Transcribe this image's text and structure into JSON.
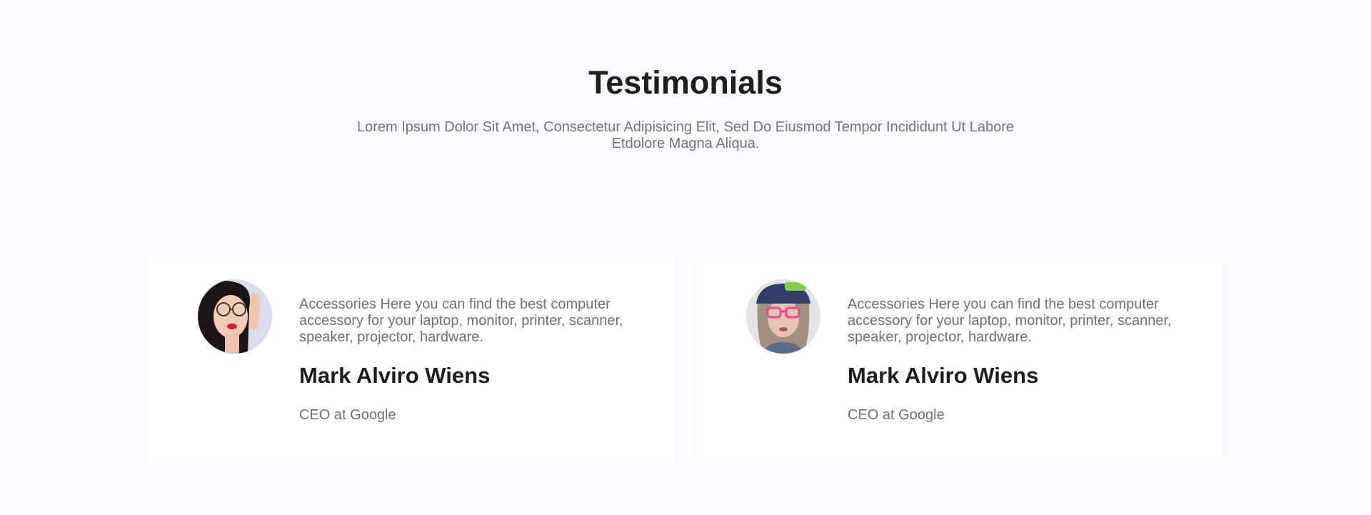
{
  "section": {
    "title": "Testimonials",
    "subtitle": "Lorem Ipsum Dolor Sit Amet, Consectetur Adipisicing Elit, Sed Do Eiusmod Tempor Incididunt Ut Labore Etdolore Magna Aliqua."
  },
  "testimonials": [
    {
      "quote": "Accessories Here you can find the best computer accessory for your laptop, monitor, printer, scanner, speaker, projector, hardware.",
      "name": "Mark Alviro Wiens",
      "role": "CEO at Google",
      "avatar": "woman-with-glasses-avatar"
    },
    {
      "quote": "Accessories Here you can find the best computer accessory for your laptop, monitor, printer, scanner, speaker, projector, hardware.",
      "name": "Mark Alviro Wiens",
      "role": "CEO at Google",
      "avatar": "woman-with-pink-glasses-avatar"
    }
  ],
  "colors": {
    "background": "#f8f9fd",
    "card": "#ffffff",
    "heading": "#1e1e1e",
    "body_text": "#6f6f6f"
  }
}
